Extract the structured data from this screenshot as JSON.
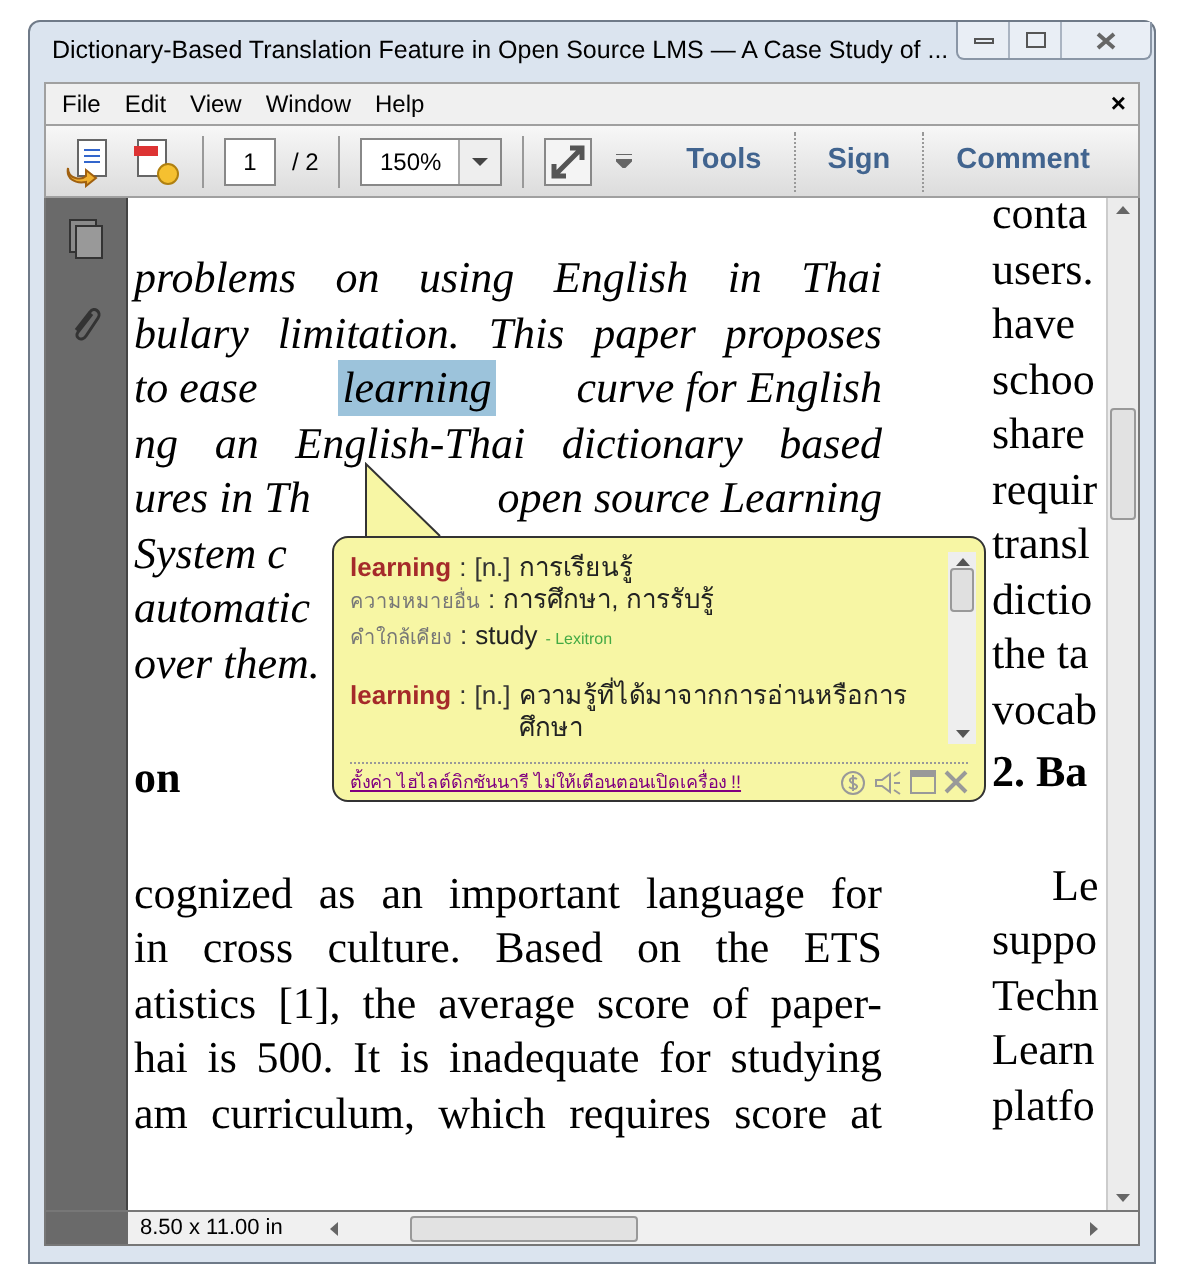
{
  "window": {
    "title": "Dictionary-Based Translation Feature in Open Source LMS — A Case Study of ..."
  },
  "menu": [
    "File",
    "Edit",
    "View",
    "Window",
    "Help"
  ],
  "menu_close": "×",
  "toolbar": {
    "page": "1",
    "page_total": "/ 2",
    "zoom": "150%",
    "buttons": [
      {
        "label": "Tools"
      },
      {
        "label": "Sign"
      },
      {
        "label": "Comment"
      }
    ]
  },
  "document": {
    "left_column": {
      "lines": [
        {
          "parts": [
            {
              "text": "problems on using English in Thai",
              "selected": false
            }
          ]
        },
        {
          "parts": [
            {
              "text": "bulary limitation. This paper proposes",
              "selected": false
            }
          ]
        },
        {
          "parts": [
            {
              "text": "to ease",
              "selected": false
            },
            {
              "text": "learning",
              "selected": true
            },
            {
              "text": "curve for English",
              "selected": false
            }
          ]
        },
        {
          "parts": [
            {
              "text": "ng an English-Thai dictionary based",
              "selected": false
            }
          ]
        },
        {
          "parts": [
            {
              "text": "ures in Th",
              "selected": false
            },
            {
              "text": "open source Learning",
              "selected": false
            }
          ]
        },
        {
          "parts": [
            {
              "text": "System c",
              "selected": false
            }
          ]
        },
        {
          "parts": [
            {
              "text": "automatic",
              "selected": false
            }
          ]
        },
        {
          "parts": [
            {
              "text": "over them.",
              "selected": false
            }
          ]
        }
      ],
      "heading": "on",
      "paragraph": [
        "cognized as an important language for",
        "in cross culture. Based on the ETS",
        "atistics [1], the average score of paper-",
        "hai is 500. It is inadequate for studying",
        "am curriculum, which requires score at"
      ]
    },
    "right_column": {
      "lines": [
        "conta",
        "users.",
        "have",
        "schoo",
        "share",
        "requir",
        "transl",
        "dictio",
        "the ta",
        "vocab"
      ],
      "heading": "2. Ba",
      "paragraph": [
        "Le",
        "suppo",
        "Techn",
        "Learn",
        "platfo"
      ]
    }
  },
  "dictionary_popup": {
    "entries": [
      {
        "word": "learning",
        "separator": ":",
        "pos": "[n.]",
        "meaning": "การเรียนรู้",
        "details": [
          {
            "label": "ความหมายอื่น",
            "separator": ":",
            "value": "การศึกษา, การรับรู้"
          },
          {
            "label": "คำใกล้เคียง",
            "separator": ":",
            "value": "study",
            "source": "- Lexitron"
          }
        ]
      },
      {
        "word": "learning",
        "separator": ":",
        "pos": "[n.]",
        "meaning": "ความรู้ที่ได้มาจากการอ่านหรือการศึกษา"
      }
    ],
    "footer_link": "ตั้งค่า ไฮไลต์ดิกชันนารี ไม่ให้เตือนตอนเปิดเครื่อง !!"
  },
  "status_bar": {
    "page_size": "8.50 x 11.00 in"
  }
}
